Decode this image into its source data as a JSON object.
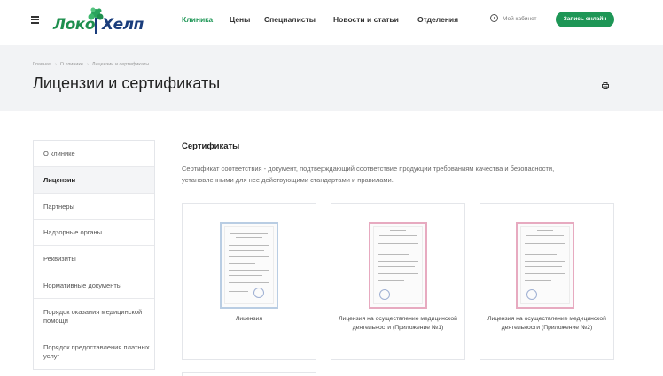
{
  "header": {
    "logo_left": "Локо",
    "logo_right": "Хелп",
    "nav": [
      "Клиника",
      "Цены",
      "Специалисты",
      "Новости и статьи",
      "Отделения"
    ],
    "cabinet_label": "Мой кабинет",
    "book_button": "Запись онлайн"
  },
  "breadcrumb": [
    "Главная",
    "О клинике",
    "Лицензии и сертификаты"
  ],
  "page_title": "Лицензии и сертификаты",
  "sidebar": {
    "items": [
      "О клинике",
      "Лицензии",
      "Партнеры",
      "Надзорные органы",
      "Реквизиты",
      "Нормативные документы",
      "Порядок оказания медицинской помощи",
      "Порядок предоставления платных услуг"
    ],
    "active_index": 1
  },
  "main": {
    "section_title": "Сертификаты",
    "description": "Сертификат соответствия - документ, подтверждающий соответствие продукции требованиям качества и безопасности, установленными для нее действующими стандартами и правилами.",
    "cards": [
      {
        "label": "Лицензия",
        "style": "blue"
      },
      {
        "label": "Лицензия на осуществление медицинской деятельности (Приложение №1)",
        "style": "pink"
      },
      {
        "label": "Лицензия на осуществление медицинской деятельности (Приложение №2)",
        "style": "pink"
      }
    ]
  },
  "icons": [
    "menu-icon",
    "user-icon",
    "print-icon",
    "chevron-right-icon"
  ],
  "colors": {
    "accent": "#1e9656",
    "logo_blue": "#1a3d7c",
    "band": "#f2f3f5"
  }
}
